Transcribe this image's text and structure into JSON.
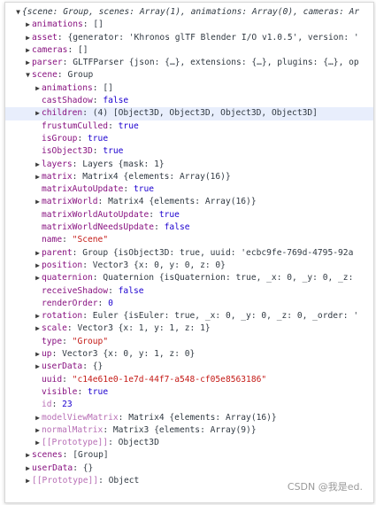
{
  "rows": [
    {
      "indent": 0,
      "tri": "down",
      "k": "",
      "text": "{scene: Group, scenes: Array(1), animations: Array(0), cameras: Ar",
      "italic": true
    },
    {
      "indent": 1,
      "tri": "right",
      "k": "animations",
      "text": "[]"
    },
    {
      "indent": 1,
      "tri": "right",
      "k": "asset",
      "text": "{generator: 'Khronos glTF Blender I/O v1.0.5', version: '"
    },
    {
      "indent": 1,
      "tri": "right",
      "k": "cameras",
      "text": "[]"
    },
    {
      "indent": 1,
      "tri": "right",
      "k": "parser",
      "text": "GLTFParser {json: {…}, extensions: {…}, plugins: {…}, op"
    },
    {
      "indent": 1,
      "tri": "down",
      "k": "scene",
      "text": "Group"
    },
    {
      "indent": 2,
      "tri": "right",
      "k": "animations",
      "text": "[]"
    },
    {
      "indent": 2,
      "tri": "none",
      "k": "castShadow",
      "text": "false"
    },
    {
      "indent": 2,
      "tri": "right",
      "k": "children",
      "text": "(4) [Object3D, Object3D, Object3D, Object3D]",
      "selected": true
    },
    {
      "indent": 2,
      "tri": "none",
      "k": "frustumCulled",
      "text": "true"
    },
    {
      "indent": 2,
      "tri": "none",
      "k": "isGroup",
      "text": "true"
    },
    {
      "indent": 2,
      "tri": "none",
      "k": "isObject3D",
      "text": "true"
    },
    {
      "indent": 2,
      "tri": "right",
      "k": "layers",
      "text": "Layers {mask: 1}"
    },
    {
      "indent": 2,
      "tri": "right",
      "k": "matrix",
      "text": "Matrix4 {elements: Array(16)}"
    },
    {
      "indent": 2,
      "tri": "none",
      "k": "matrixAutoUpdate",
      "text": "true"
    },
    {
      "indent": 2,
      "tri": "right",
      "k": "matrixWorld",
      "text": "Matrix4 {elements: Array(16)}"
    },
    {
      "indent": 2,
      "tri": "none",
      "k": "matrixWorldAutoUpdate",
      "text": "true"
    },
    {
      "indent": 2,
      "tri": "none",
      "k": "matrixWorldNeedsUpdate",
      "text": "false"
    },
    {
      "indent": 2,
      "tri": "none",
      "k": "name",
      "text": "\"Scene\""
    },
    {
      "indent": 2,
      "tri": "right",
      "k": "parent",
      "text": "Group {isObject3D: true, uuid: 'ecbc9fe-769d-4795-92a"
    },
    {
      "indent": 2,
      "tri": "right",
      "k": "position",
      "text": "Vector3 {x: 0, y: 0, z: 0}"
    },
    {
      "indent": 2,
      "tri": "right",
      "k": "quaternion",
      "text": "Quaternion {isQuaternion: true, _x: 0, _y: 0, _z:"
    },
    {
      "indent": 2,
      "tri": "none",
      "k": "receiveShadow",
      "text": "false"
    },
    {
      "indent": 2,
      "tri": "none",
      "k": "renderOrder",
      "text": "0"
    },
    {
      "indent": 2,
      "tri": "right",
      "k": "rotation",
      "text": "Euler {isEuler: true, _x: 0, _y: 0, _z: 0, _order: '"
    },
    {
      "indent": 2,
      "tri": "right",
      "k": "scale",
      "text": "Vector3 {x: 1, y: 1, z: 1}"
    },
    {
      "indent": 2,
      "tri": "none",
      "k": "type",
      "text": "\"Group\""
    },
    {
      "indent": 2,
      "tri": "right",
      "k": "up",
      "text": "Vector3 {x: 0, y: 1, z: 0}"
    },
    {
      "indent": 2,
      "tri": "right",
      "k": "userData",
      "text": "{}"
    },
    {
      "indent": 2,
      "tri": "none",
      "k": "uuid",
      "text": "\"c14e61e0-1e7d-44f7-a548-cf05e8563186\""
    },
    {
      "indent": 2,
      "tri": "none",
      "k": "visible",
      "text": "true"
    },
    {
      "indent": 2,
      "tri": "none",
      "k": "id",
      "text": "23",
      "dim": true
    },
    {
      "indent": 2,
      "tri": "right",
      "k": "modelViewMatrix",
      "text": "Matrix4 {elements: Array(16)}",
      "dim": true
    },
    {
      "indent": 2,
      "tri": "right",
      "k": "normalMatrix",
      "text": "Matrix3 {elements: Array(9)}",
      "dim": true
    },
    {
      "indent": 2,
      "tri": "right",
      "k": "[[Prototype]]",
      "text": "Object3D",
      "dim": true
    },
    {
      "indent": 1,
      "tri": "right",
      "k": "scenes",
      "text": "[Group]"
    },
    {
      "indent": 1,
      "tri": "right",
      "k": "userData",
      "text": "{}"
    },
    {
      "indent": 1,
      "tri": "right",
      "k": "[[Prototype]]",
      "text": "Object",
      "dim": true
    }
  ],
  "watermark": "CSDN @我是ed."
}
